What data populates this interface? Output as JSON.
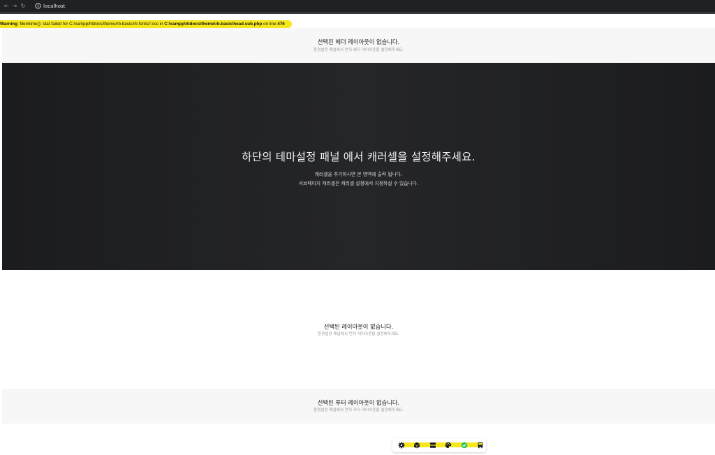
{
  "browser": {
    "url": "localhost"
  },
  "warning": {
    "label": "Warning",
    "text_a": ": filemtime(): stat failed for C:/xampp/htdocs/theme/rb.basic/rb.fonts//.css in ",
    "path": "C:\\xampp\\htdocs\\theme\\rb.basic\\head.sub.php",
    "text_b": " on line ",
    "line": "476"
  },
  "header_section": {
    "title": "선택된 헤더 레이아웃이 없습니다.",
    "subtitle": "환경설정 패널에서 먼저 헤더 레이아웃을 설정해주세요."
  },
  "carousel": {
    "title": "하단의 테마설정 패널 에서 캐러셀을 설정해주세요.",
    "line1": "캐러셀을 추가하시면 본 영역에 출력 됩니다.",
    "line2": "서브페이지 캐러셀은 캐러셀 설정에서 지정하실 수 있습니다."
  },
  "main_section": {
    "title": "선택된 레이아웃이 없습니다.",
    "subtitle": "환경설정 패널에서 먼저 레이아웃을 설정해주세요."
  },
  "footer_section": {
    "title": "선택된 푸터 레이아웃이 없습니다.",
    "subtitle": "환경설정 패널에서 먼저 푸터 레이아웃을 설정해주세요."
  },
  "toolbar": {
    "icons": [
      "gear-icon",
      "cube-icon",
      "layers-icon",
      "palette-icon",
      "check-circle-icon",
      "bus-icon"
    ],
    "accent": "#22c55e",
    "highlight": "#f6e71d"
  }
}
